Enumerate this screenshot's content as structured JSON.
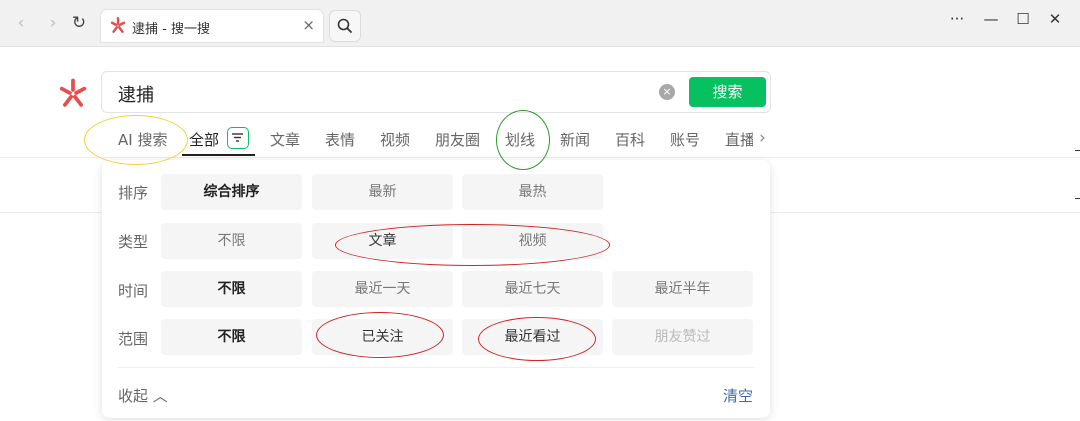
{
  "browser": {
    "tab_title": "逮捕 - 搜一搜",
    "tab_close": "×",
    "back_glyph": "‹",
    "forward_glyph": "›",
    "refresh_glyph": "↻",
    "more_glyph": "···",
    "minimize_glyph": "—",
    "maximize_glyph": "☐",
    "close_glyph": "✕"
  },
  "search": {
    "query": "逮捕",
    "clear_glyph": "×",
    "button_label": "搜索"
  },
  "categories": [
    {
      "label": "AI 搜索"
    },
    {
      "label": "全部"
    },
    {
      "label": "文章"
    },
    {
      "label": "表情"
    },
    {
      "label": "视频"
    },
    {
      "label": "朋友圈"
    },
    {
      "label": "划线"
    },
    {
      "label": "新闻"
    },
    {
      "label": "百科"
    },
    {
      "label": "账号"
    },
    {
      "label": "直播"
    }
  ],
  "filters": {
    "sort": {
      "label": "排序",
      "options": [
        "综合排序",
        "最新",
        "最热"
      ],
      "selected": "综合排序"
    },
    "type": {
      "label": "类型",
      "options": [
        "不限",
        "文章",
        "视频"
      ],
      "selected": ""
    },
    "time": {
      "label": "时间",
      "options": [
        "不限",
        "最近一天",
        "最近七天",
        "最近半年"
      ],
      "selected": "不限"
    },
    "scope": {
      "label": "范围",
      "options": [
        "不限",
        "已关注",
        "最近看过",
        "朋友赞过"
      ],
      "selected": "不限",
      "disabled": "朋友赞过"
    },
    "collapse_label": "收起 ︿",
    "clear_label": "清空"
  },
  "colors": {
    "accent": "#07c160",
    "brand_red": "#e84d4d",
    "link": "#3b6ea8",
    "annotation_red": "#d22222",
    "annotation_green": "#2e9b2e",
    "annotation_yellow": "#f1d23c"
  },
  "icons": [
    "asterisk-logo-icon",
    "search-icon",
    "filter-icon",
    "clear-icon",
    "chevron-right-icon"
  ]
}
